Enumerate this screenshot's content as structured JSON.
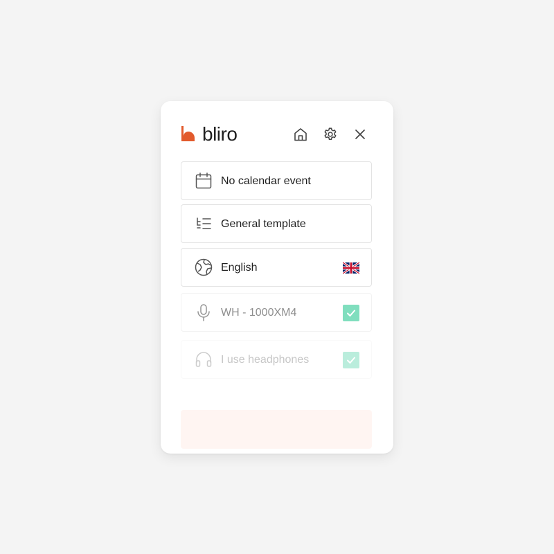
{
  "app": {
    "logo_text": "bliro",
    "brand_color": "#e25a2c"
  },
  "header": {
    "home_icon": "home-icon",
    "settings_icon": "gear-icon",
    "close_icon": "close-icon"
  },
  "options": {
    "calendar": {
      "icon": "calendar-icon",
      "label": "No calendar event"
    },
    "template": {
      "icon": "list-icon",
      "label": "General template"
    },
    "language": {
      "icon": "globe-icon",
      "label": "English",
      "flag": "uk-flag-icon"
    },
    "microphone": {
      "icon": "microphone-icon",
      "label": "WH - 1000XM4",
      "checked": true
    },
    "headphones": {
      "icon": "headphones-icon",
      "label": "I use headphones",
      "checked": true
    }
  },
  "colors": {
    "check": "#5dd6ad",
    "start_bg": "#fff5f2"
  }
}
